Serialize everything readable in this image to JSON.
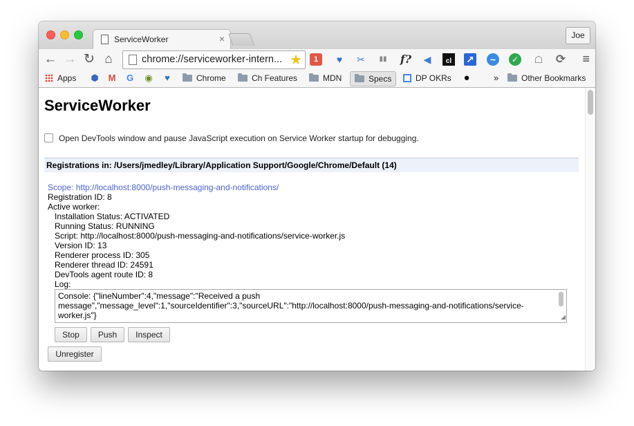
{
  "tab": {
    "title": "ServiceWorker",
    "close": "×"
  },
  "profile": {
    "name": "Joe"
  },
  "toolbar": {
    "back": "←",
    "forward": "→",
    "reload": "↻",
    "home": "⌂",
    "url": "chrome://serviceworker-intern...",
    "star": "★",
    "menu": "≡"
  },
  "extensions": [
    {
      "name": "ext-red-1",
      "glyph": "1",
      "color": "#e25844"
    },
    {
      "name": "ext-heart",
      "glyph": "♥",
      "color": "#2f74c0"
    },
    {
      "name": "ext-scissors",
      "glyph": "✂",
      "color": "#3b7bd4"
    },
    {
      "name": "ext-columns",
      "glyph": "▮▮",
      "color": "#888888"
    },
    {
      "name": "ext-fquestion",
      "glyph": "f?",
      "color": "#333333"
    },
    {
      "name": "ext-megaphone",
      "glyph": "◀",
      "color": "#3b7bd4"
    },
    {
      "name": "ext-cl",
      "glyph": "cl",
      "color": "#111111"
    },
    {
      "name": "ext-arrow",
      "glyph": "↗",
      "color": "#2a67d6"
    },
    {
      "name": "ext-pulse",
      "glyph": "~",
      "color": "#3b8be0"
    },
    {
      "name": "ext-check",
      "glyph": "✓",
      "color": "#2fa84f"
    },
    {
      "name": "ext-ghost",
      "glyph": "☖",
      "color": "#777777"
    },
    {
      "name": "ext-sync",
      "glyph": "⟳",
      "color": "#666666"
    }
  ],
  "bookmarks": {
    "apps": "Apps",
    "chrome": "Chrome",
    "ch_features": "Ch Features",
    "mdn": "MDN",
    "specs": "Specs",
    "dp_okrs": "DP OKRs",
    "overflow": "»",
    "other": "Other Bookmarks"
  },
  "page": {
    "title": "ServiceWorker",
    "debug_label": "Open DevTools window and pause JavaScript execution on Service Worker startup for debugging.",
    "registrations_header": "Registrations in: /Users/jmedley/Library/Application Support/Google/Chrome/Default (14)",
    "scope": "Scope: http://localhost:8000/push-messaging-and-notifications/",
    "registration_id": "Registration ID: 8",
    "active_worker": "Active worker:",
    "installation_status": "Installation Status: ACTIVATED",
    "running_status": "Running Status: RUNNING",
    "script": "Script: http://localhost:8000/push-messaging-and-notifications/service-worker.js",
    "version_id": "Version ID: 13",
    "renderer_process_id": "Renderer process ID: 305",
    "renderer_thread_id": "Renderer thread ID: 24591",
    "devtools_route_id": "DevTools agent route ID: 8",
    "log_label": "Log:",
    "log_text": "Console: {\"lineNumber\":4,\"message\":\"Received a push message\",\"message_level\":1,\"sourceIdentifier\":3,\"sourceURL\":\"http://localhost:8000/push-messaging-and-notifications/service-worker.js\"}",
    "buttons": {
      "stop": "Stop",
      "push": "Push",
      "inspect": "Inspect",
      "unregister": "Unregister"
    }
  }
}
